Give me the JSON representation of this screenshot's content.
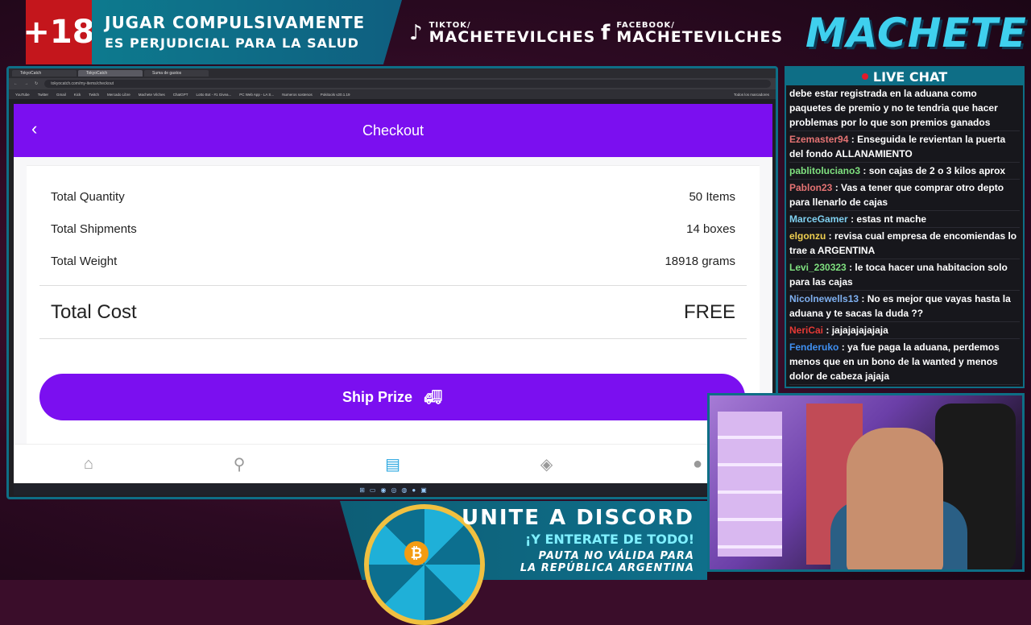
{
  "overlay": {
    "age_badge": "+18",
    "warning_line1": "JUGAR COMPULSIVAMENTE",
    "warning_line2": "ES PERJUDICIAL PARA LA SALUD",
    "tiktok_label": "TIKTOK/",
    "tiktok_handle": "MACHETEVILCHES",
    "facebook_label": "FACEBOOK/",
    "facebook_handle": "MACHETEVILCHES",
    "brand": "MACHETE"
  },
  "browser": {
    "tabs": [
      "TokyoCatch",
      "TokyoCatch",
      "Suma de gastos"
    ],
    "url": "tokyocatch.com/my-items/checkout",
    "bookmarks": [
      "YouTube",
      "Twitter",
      "Gmail",
      "Kick",
      "Twitch",
      "Mercado Libre",
      "Machete Vilches",
      "ChatGPT",
      "Lotto Bot - #1 Givea...",
      "PC Web App - LA S...",
      "Numeros sostenos",
      "Pokitools v20.1.19",
      "Todos los marcadores"
    ]
  },
  "checkout": {
    "title": "Checkout",
    "rows": [
      {
        "label": "Total Quantity",
        "value": "50 Items"
      },
      {
        "label": "Total Shipments",
        "value": "14 boxes"
      },
      {
        "label": "Total Weight",
        "value": "18918 grams"
      }
    ],
    "total_label": "Total Cost",
    "total_value": "FREE",
    "ship_button": "Ship Prize"
  },
  "chat": {
    "title": "LIVE CHAT",
    "messages": [
      {
        "user": "",
        "text": "debe estar registrada en la aduana como paquetes de premio y no te tendria que hacer problemas por lo que son premios ganados",
        "color": "#ffffff"
      },
      {
        "user": "Ezemaster94",
        "text": ": Enseguida le revientan la puerta del fondo ALLANAMIENTO",
        "color": "#e57373"
      },
      {
        "user": "pablitoluciano3",
        "text": ": son cajas de 2 o 3 kilos aprox",
        "color": "#7fe07f"
      },
      {
        "user": "Pablon23",
        "text": ": Vas a tener que comprar otro depto para llenarlo de cajas",
        "color": "#e57373"
      },
      {
        "user": "MarceGamer",
        "text": ": estas nt mache",
        "color": "#7fd0f0"
      },
      {
        "user": "elgonzu",
        "text": ": revisa cual empresa de encomiendas lo trae a ARGENTINA",
        "color": "#f0d050"
      },
      {
        "user": "Levi_230323",
        "text": ": le toca hacer una habitacion solo para las cajas",
        "color": "#7fe07f"
      },
      {
        "user": "Nicolnewells13",
        "text": ": No es mejor que vayas hasta la aduana y te sacas la duda ??",
        "color": "#7fb0f0"
      },
      {
        "user": "NeriCai",
        "text": ": jajajajajajaja",
        "color": "#e53935"
      },
      {
        "user": "Fenderuko",
        "text": ": ya fue paga la aduana, perdemos menos que en un bono de la wanted y menos dolor de cabeza jajaja",
        "color": "#3f8ff0"
      }
    ]
  },
  "discord": {
    "line1": "UNITE A DISCORD",
    "line2": "¡Y ENTERATE DE TODO!",
    "line3": "PAUTA NO VÁLIDA PARA",
    "line4": "LA REPÚBLICA ARGENTINA"
  },
  "colors": {
    "accent": "#7b0ff0",
    "overlay": "#0e6e86"
  }
}
